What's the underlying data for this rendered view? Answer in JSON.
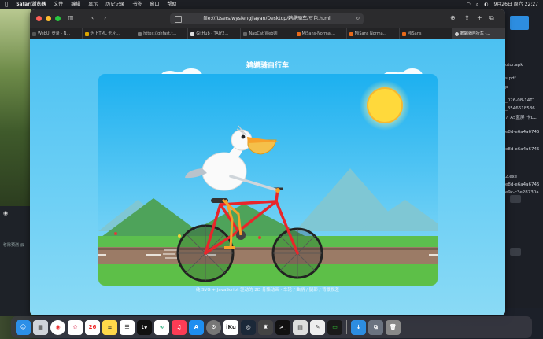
{
  "menubar": {
    "app": "Safari浏览器",
    "items": [
      "文件",
      "编辑",
      "显示",
      "历史记录",
      "书签",
      "窗口",
      "帮助"
    ],
    "clock": "9月26日 周六 22:27"
  },
  "browser": {
    "url": "file:///Users/wysfengjiayan/Desktop/鹈鹕骑车/豆包.html",
    "tabs": [
      {
        "label": "WebUI 登录 - N..."
      },
      {
        "label": "为 HTML 卡片..."
      },
      {
        "label": "https://ghfast.t..."
      },
      {
        "label": "GitHub - TAIY2..."
      },
      {
        "label": "NapCat WebUI"
      },
      {
        "label": "MiSans-Normal..."
      },
      {
        "label": "MiSans Norma..."
      },
      {
        "label": "MiSans"
      },
      {
        "label": "鹈鹕骑自行车 -..."
      }
    ]
  },
  "page": {
    "title": "鹈鹕骑自行车",
    "caption": "纯 SVG + JavaScript 驱动的 2D 骨骼动画 · 车轮 / 曲柄 / 腿部 / 背景视差"
  },
  "sidebar_files": [
    "otor.apk",
    "s.pdf",
    "p",
    "_026-08-14T1",
    "_3546618586",
    "7_A5蓝屏_卡LC",
    "e8d-e6a4a6745",
    "e8d-e6a4a6745",
    "2.exe",
    "e8d-e6a4a6745",
    "e9c-c3e28730a"
  ],
  "leftpanel": {
    "item": "移除预测-云"
  },
  "dock": {
    "apps": [
      "finder",
      "launchpad",
      "chrome",
      "photos",
      "calendar",
      "notes",
      "reminders",
      "apple-tv",
      "freeform",
      "music",
      "app-store",
      "settings",
      "iku",
      "steam",
      "terminal",
      "disk-utility",
      "script-editor",
      "monitor",
      "downloads",
      "stack",
      "trash"
    ],
    "calendar_day": "26",
    "iku_label": "iKu"
  },
  "colors": {
    "sky": "#4cc1f2",
    "bike_frame": "#e8262b",
    "beak": "#f7a12a",
    "sun": "#ffd93b"
  }
}
